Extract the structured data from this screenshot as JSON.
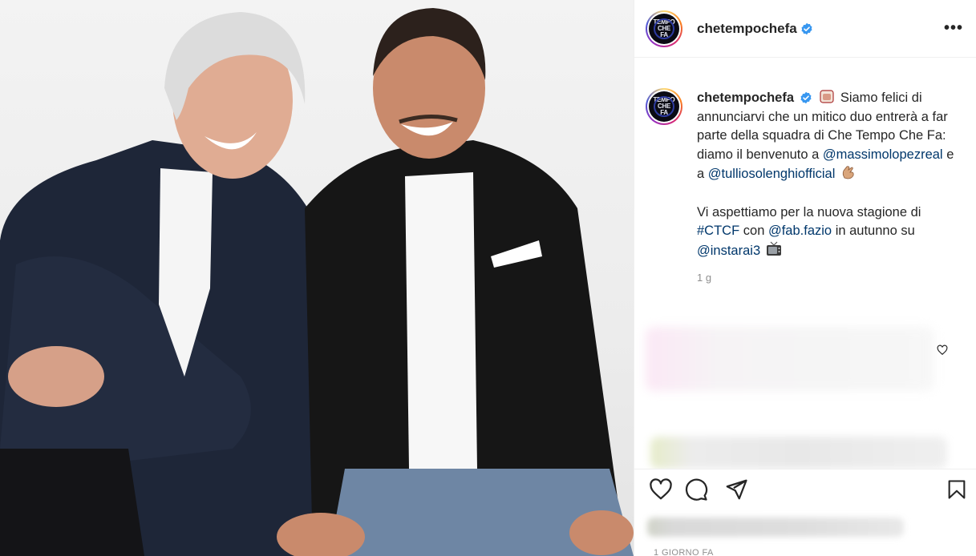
{
  "post": {
    "username": "chetempochefa",
    "avatar_text": [
      "TEMPO",
      "CHE",
      "FA"
    ],
    "more_label": "•••",
    "caption": {
      "emoji_1": "clapper",
      "text_1": "Siamo felici di annunciarvi che un mitico duo entrerà a far parte della squadra di Che Tempo Che Fa: diamo il benvenuto a",
      "mention_1": "@massimolopezreal",
      "text_2": "e a",
      "mention_2": "@tulliosolenghiofficial",
      "emoji_2": "clapping-hands",
      "text_3": "Vi aspettiamo per la nuova stagione di",
      "hashtag": "#CTCF",
      "text_4": "con",
      "mention_3": "@fab.fazio",
      "text_5": "in autunno su",
      "mention_4": "@instarai3",
      "emoji_3": "television",
      "time": "1 g"
    },
    "footer_time": "1 GIORNO FA"
  },
  "colors": {
    "link": "#00376b",
    "verified": "#3897f0",
    "text": "#262626",
    "muted": "#8e8e8e"
  },
  "icons": [
    "heart-icon",
    "comment-icon",
    "share-icon",
    "bookmark-icon",
    "verified-icon",
    "more-icon"
  ]
}
